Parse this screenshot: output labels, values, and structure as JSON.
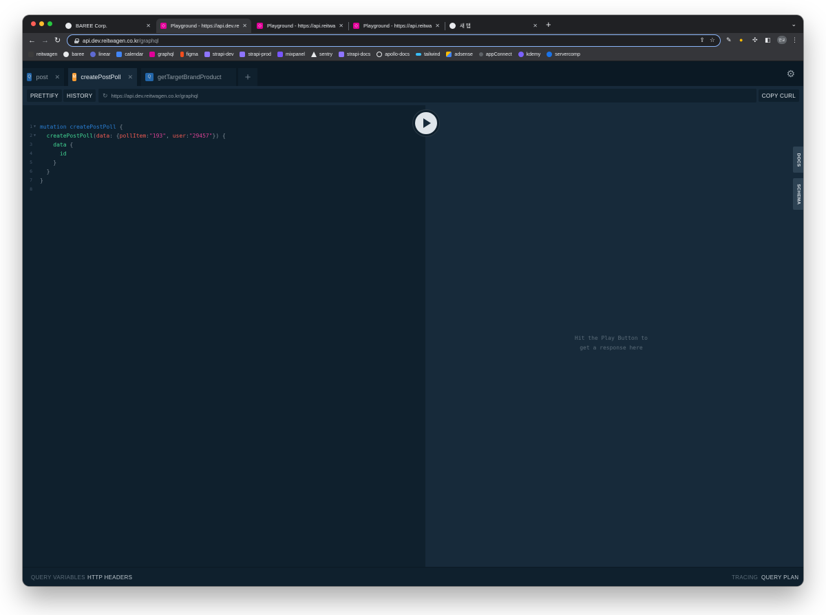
{
  "browser": {
    "tabs": [
      {
        "title": "BAREE Corp.",
        "icon": "github-icon"
      },
      {
        "title": "Playground - https://api.dev.re",
        "icon": "graphql-icon"
      },
      {
        "title": "Playground - https://api.reitwa",
        "icon": "graphql-icon"
      },
      {
        "title": "Playground - https://api.reitwa",
        "icon": "graphql-icon"
      },
      {
        "title": "새 탭",
        "icon": "chrome-icon"
      }
    ],
    "url_host": "api.dev.reitwagen.co.kr",
    "url_path": "/graphql",
    "profile_label": "반교",
    "bookmarks": [
      {
        "label": "reitwagen",
        "color": "#3c3c3c"
      },
      {
        "label": "baree",
        "color": "#e8eaed"
      },
      {
        "label": "linear",
        "color": "#5e6ad2"
      },
      {
        "label": "calendar",
        "color": "#4285f4"
      },
      {
        "label": "graphql",
        "color": "#e10098"
      },
      {
        "label": "figma",
        "color": "#f24e1e"
      },
      {
        "label": "strapi-dev",
        "color": "#8e75ff"
      },
      {
        "label": "strapi-prod",
        "color": "#8e75ff"
      },
      {
        "label": "mixpanel",
        "color": "#7856ff"
      },
      {
        "label": "sentry",
        "color": "#e8eaed"
      },
      {
        "label": "strapi-docs",
        "color": "#8e75ff"
      },
      {
        "label": "apollo-docs",
        "color": "#e8eaed"
      },
      {
        "label": "tailwind",
        "color": "#38bdf8"
      },
      {
        "label": "adsense",
        "color": "#fbbc04"
      },
      {
        "label": "appConnect",
        "color": "#5f6368"
      },
      {
        "label": "kdemy",
        "color": "#7b61ff"
      },
      {
        "label": "servercomp",
        "color": "#1a73e8"
      }
    ]
  },
  "playground": {
    "tabs": [
      {
        "badge": "Q",
        "label": "post"
      },
      {
        "badge": "M",
        "label": "createPostPoll"
      },
      {
        "badge": "Q",
        "label": "getTargetBrandProduct"
      }
    ],
    "prettify_label": "PRETTIFY",
    "history_label": "HISTORY",
    "endpoint": "https://api.dev.reitwagen.co.kr/graphql",
    "copy_curl_label": "COPY CURL",
    "code": {
      "line_numbers": [
        "1",
        "2",
        "3",
        "4",
        "5",
        "6",
        "7",
        "8"
      ],
      "l1_kw": "mutation",
      "l1_name": "createPostPoll",
      "l1_brace": " {",
      "l2_field": "createPostPoll",
      "l2_open": "(",
      "l2_arg": "data",
      "l2_colon": ": {",
      "l2_key1": "pollItem",
      "l2_val1": "\"193\"",
      "l2_comma": ", ",
      "l2_key2": "user",
      "l2_val2": "\"29457\"",
      "l2_close": "}) {",
      "l3_field": "data",
      "l3_brace": " {",
      "l4_field": "id",
      "close_brace": "}"
    },
    "result_hint_1": "Hit the Play Button to",
    "result_hint_2": "get a response here",
    "docs_label": "DOCS",
    "schema_label": "SCHEMA",
    "query_variables_label": "QUERY VARIABLES",
    "http_headers_label": "HTTP HEADERS",
    "tracing_label": "TRACING",
    "query_plan_label": "QUERY PLAN"
  }
}
